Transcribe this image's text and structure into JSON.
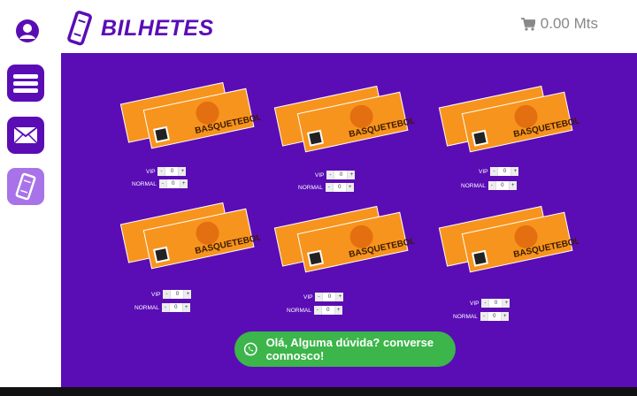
{
  "header": {
    "title": "BILHETES",
    "cart_total": "0.00 Mts"
  },
  "ticket_text": "BASQUETEBOL",
  "tickets": [
    {
      "vip_label": "VIP",
      "vip_qty": "0",
      "normal_label": "NORMAL",
      "normal_qty": "0"
    },
    {
      "vip_label": "VIP",
      "vip_qty": "0",
      "normal_label": "NORMAL",
      "normal_qty": "0"
    },
    {
      "vip_label": "VIP",
      "vip_qty": "0",
      "normal_label": "NORMAL",
      "normal_qty": "0"
    },
    {
      "vip_label": "VIP",
      "vip_qty": "0",
      "normal_label": "NORMAL",
      "normal_qty": "0"
    },
    {
      "vip_label": "VIP",
      "vip_qty": "0",
      "normal_label": "NORMAL",
      "normal_qty": "0"
    },
    {
      "vip_label": "VIP",
      "vip_qty": "0",
      "normal_label": "NORMAL",
      "normal_qty": "0"
    }
  ],
  "stepper": {
    "minus": "-",
    "plus": "+"
  },
  "chat": {
    "text": "Olá, Alguma dúvida? converse connosco!"
  },
  "colors": {
    "primary": "#5a0db5",
    "sidebar_active": "#a873e8",
    "ticket": "#f7941d",
    "chat": "#3cb54a"
  },
  "icons": {
    "user": "user-icon",
    "menu": "menu-icon",
    "mail": "mail-icon",
    "ticket": "ticket-icon",
    "cart": "cart-icon",
    "chat": "whatsapp-icon"
  }
}
